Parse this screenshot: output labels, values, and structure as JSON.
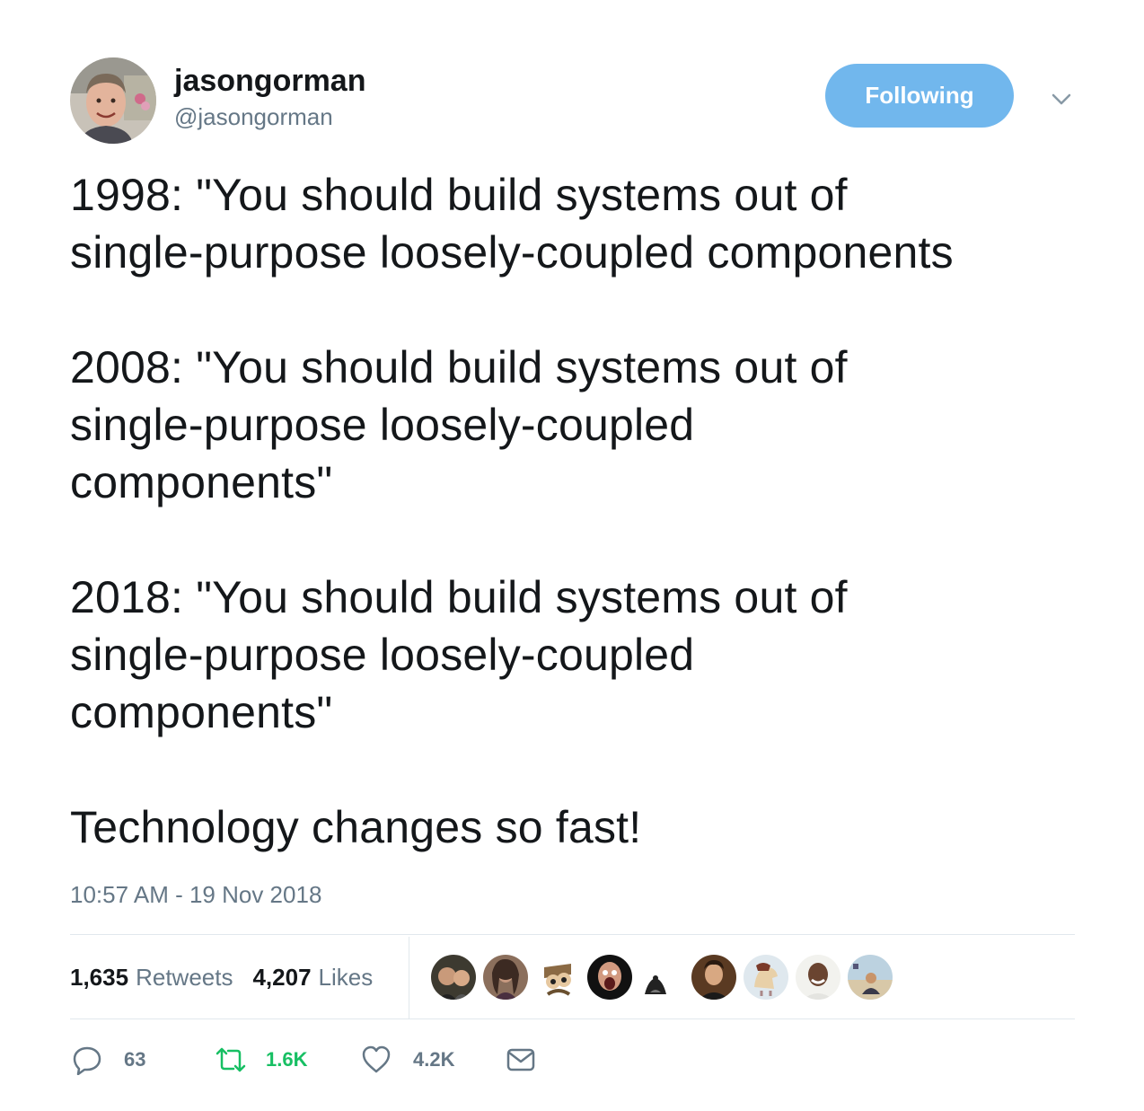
{
  "user": {
    "display_name": "jasongorman",
    "handle": "@jasongorman",
    "follow_button_label": "Following"
  },
  "tweet": {
    "paragraphs": [
      "1998: \"You should build systems out of\nsingle-purpose loosely-coupled components",
      "2008: \"You should build systems out of\nsingle-purpose loosely-coupled\ncomponents\"",
      "2018: \"You should build systems out of\nsingle-purpose loosely-coupled\ncomponents\"",
      "Technology changes so fast!"
    ],
    "timestamp": "10:57 AM - 19 Nov 2018"
  },
  "stats": {
    "retweets_count": "1,635",
    "retweets_label": "Retweets",
    "likes_count": "4,207",
    "likes_label": "Likes"
  },
  "actions": {
    "reply_count": "63",
    "retweet_count": "1.6K",
    "like_count": "4.2K"
  },
  "icons": {
    "reply": "reply-icon",
    "retweet": "retweet-icon",
    "like": "heart-icon",
    "dm": "envelope-icon",
    "caret": "chevron-down-icon"
  },
  "colors": {
    "follow_button": "#71b7ed",
    "text_primary": "#14171a",
    "text_secondary": "#657786",
    "retweet_green": "#17bf63",
    "divider": "#e1e8ed"
  }
}
